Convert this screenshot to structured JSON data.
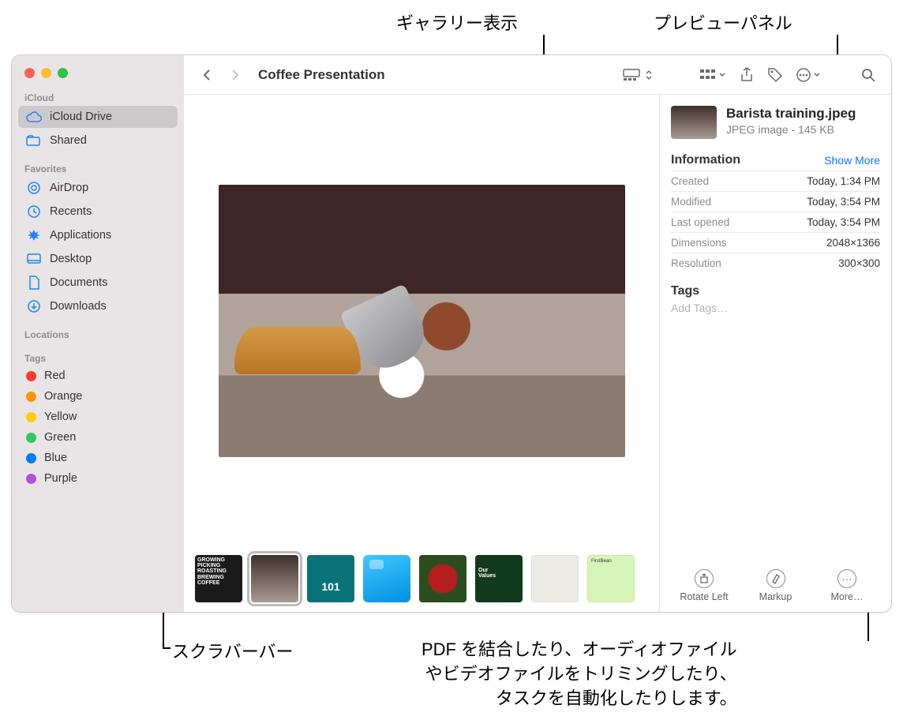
{
  "callouts": {
    "gallery_view": "ギャラリー表示",
    "preview_panel": "プレビューパネル",
    "scrubber_bar": "スクラバーバー",
    "more_desc": "PDF を結合したり、オーディオファイル\nやビデオファイルをトリミングしたり、\nタスクを自動化したりします。"
  },
  "window": {
    "title": "Coffee Presentation"
  },
  "sidebar": {
    "sections": {
      "icloud": {
        "label": "iCloud",
        "items": [
          {
            "icon": "cloud",
            "label": "iCloud Drive",
            "selected": true
          },
          {
            "icon": "folder-shared",
            "label": "Shared"
          }
        ]
      },
      "favorites": {
        "label": "Favorites",
        "items": [
          {
            "icon": "airdrop",
            "label": "AirDrop"
          },
          {
            "icon": "clock",
            "label": "Recents"
          },
          {
            "icon": "apps",
            "label": "Applications"
          },
          {
            "icon": "desktop",
            "label": "Desktop"
          },
          {
            "icon": "doc",
            "label": "Documents"
          },
          {
            "icon": "download",
            "label": "Downloads"
          }
        ]
      },
      "locations": {
        "label": "Locations"
      },
      "tags": {
        "label": "Tags",
        "items": [
          {
            "color": "#ff3b30",
            "label": "Red"
          },
          {
            "color": "#ff9500",
            "label": "Orange"
          },
          {
            "color": "#ffcc00",
            "label": "Yellow"
          },
          {
            "color": "#34c759",
            "label": "Green"
          },
          {
            "color": "#007aff",
            "label": "Blue"
          },
          {
            "color": "#af52de",
            "label": "Purple"
          }
        ]
      }
    }
  },
  "scrubber": {
    "items": [
      {
        "name": "growing-picking-roasting",
        "text": "GROWING\nPICKING\nROASTING\nBREWING\nCOFFEE"
      },
      {
        "name": "barista-training",
        "selected": true
      },
      {
        "name": "coffee-101",
        "text": "101"
      },
      {
        "name": "folder"
      },
      {
        "name": "berries"
      },
      {
        "name": "our-values",
        "text": "Our\nValues"
      },
      {
        "name": "classroom"
      },
      {
        "name": "firstbean-invoice",
        "text": "FirstBean"
      }
    ]
  },
  "preview": {
    "filename": "Barista training.jpeg",
    "subtitle": "JPEG image - 145 KB",
    "info_header": "Information",
    "show_more": "Show More",
    "rows": [
      {
        "k": "Created",
        "v": "Today, 1:34 PM"
      },
      {
        "k": "Modified",
        "v": "Today, 3:54 PM"
      },
      {
        "k": "Last opened",
        "v": "Today, 3:54 PM"
      },
      {
        "k": "Dimensions",
        "v": "2048×1366"
      },
      {
        "k": "Resolution",
        "v": "300×300"
      }
    ],
    "tags_header": "Tags",
    "tags_placeholder": "Add Tags…",
    "actions": {
      "rotate": "Rotate Left",
      "markup": "Markup",
      "more": "More…"
    }
  }
}
